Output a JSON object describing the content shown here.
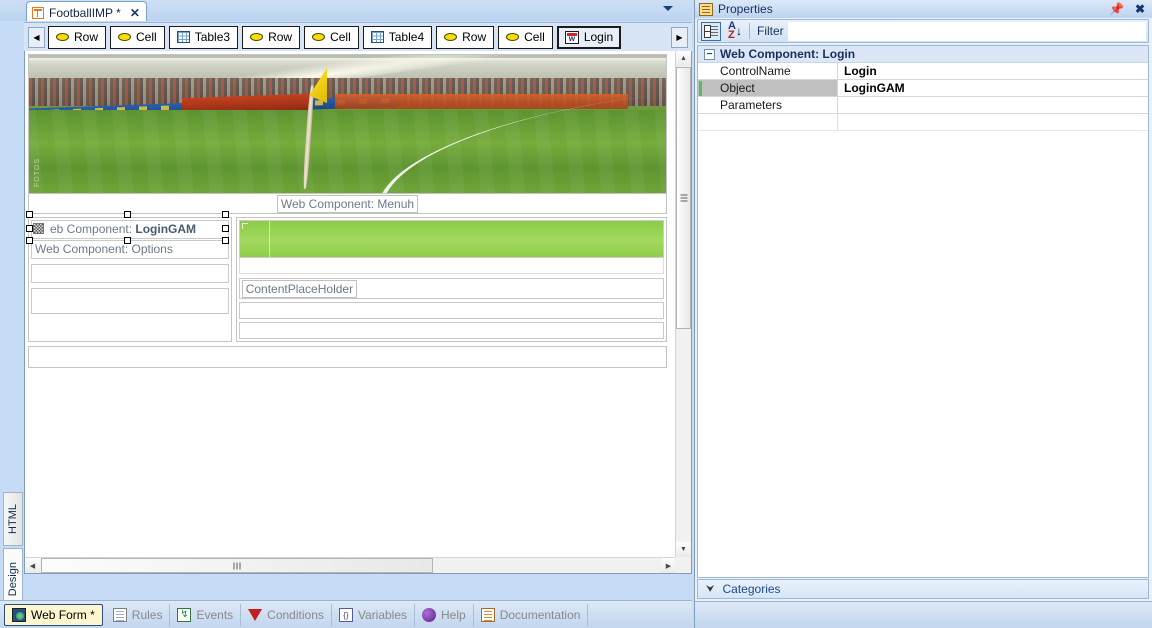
{
  "document_tab": {
    "label": "FootballIMP *",
    "icon": "webform-icon",
    "close_label": "✕",
    "dropdown_icon": "chevron-down-icon"
  },
  "breadcrumb": {
    "nav_back_icon": "chevron-left-icon",
    "nav_forward_icon": "chevron-right-icon",
    "items": [
      {
        "label": "Row",
        "icon": "row-icon",
        "selected": false
      },
      {
        "label": "Cell",
        "icon": "cell-icon",
        "selected": false
      },
      {
        "label": "Table3",
        "icon": "table-icon",
        "selected": false
      },
      {
        "label": "Row",
        "icon": "row-icon",
        "selected": false
      },
      {
        "label": "Cell",
        "icon": "cell-icon",
        "selected": false
      },
      {
        "label": "Table4",
        "icon": "table-icon",
        "selected": false
      },
      {
        "label": "Row",
        "icon": "row-icon",
        "selected": false
      },
      {
        "label": "Cell",
        "icon": "cell-icon",
        "selected": false
      },
      {
        "label": "Login",
        "icon": "web-component-icon",
        "selected": true
      }
    ]
  },
  "canvas": {
    "banner_watermark": "FOTOS",
    "menuh_label": "Web Component: Menuh",
    "logingam_label_prefix": "eb Component: ",
    "logingam_label_bold": "LoginGAM",
    "options_label": "Web Component: Options",
    "content_placeholder_label": "ContentPlaceHolder",
    "green_band_color": "#9ad455"
  },
  "view_tabs": [
    {
      "label": "HTML",
      "active": false
    },
    {
      "label": "Design",
      "active": true
    }
  ],
  "bottom_tabs": [
    {
      "label": "Web Form *",
      "icon": "webform-icon",
      "active": true
    },
    {
      "label": "Rules",
      "icon": "rules-icon",
      "active": false
    },
    {
      "label": "Events",
      "icon": "events-icon",
      "active": false
    },
    {
      "label": "Conditions",
      "icon": "conditions-icon",
      "active": false
    },
    {
      "label": "Variables",
      "icon": "variables-icon",
      "active": false
    },
    {
      "label": "Help",
      "icon": "help-icon",
      "active": false
    },
    {
      "label": "Documentation",
      "icon": "documentation-icon",
      "active": false
    }
  ],
  "properties": {
    "title": "Properties",
    "title_icon": "properties-icon",
    "pin_icon": "pin-icon",
    "close_icon": "close-icon",
    "toolbar": {
      "categorized_icon": "categorized-view-icon",
      "alphabetical_icon": "alphabetical-sort-icon",
      "filter_label": "Filter",
      "filter_value": "",
      "filter_placeholder": ""
    },
    "group": {
      "label": "Web Component: Login",
      "expander": "−"
    },
    "rows": [
      {
        "name": "ControlName",
        "value": "Login",
        "selected": false
      },
      {
        "name": "Object",
        "value": "LoginGAM",
        "selected": true
      },
      {
        "name": "Parameters",
        "value": "",
        "selected": false
      }
    ],
    "categories_label": "Categories",
    "categories_chevron": "chevrons-down-icon",
    "highlight_color": "#e51400"
  }
}
